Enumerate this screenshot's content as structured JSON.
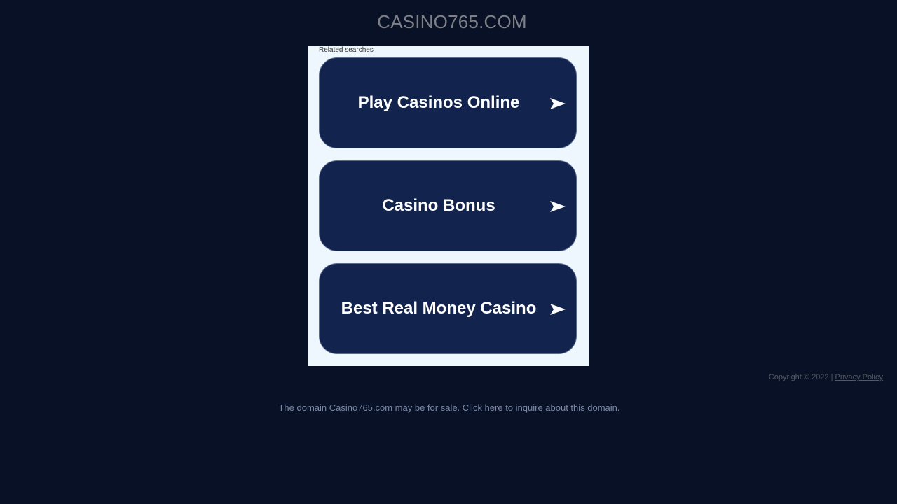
{
  "header": {
    "domain_title": "CASINO765.COM"
  },
  "related": {
    "label": "Related searches",
    "items": [
      {
        "label": "Play Casinos Online"
      },
      {
        "label": "Casino Bonus"
      },
      {
        "label": "Best Real Money Casino"
      }
    ],
    "arrow_icon": "arrow-right-icon"
  },
  "footer": {
    "copyright_text": "Copyright © 2022 |",
    "privacy_link": "Privacy Policy",
    "sale_notice": "The domain Casino765.com may be for sale. Click here to inquire about this domain."
  },
  "colors": {
    "background": "#091126",
    "panel": "#eef7fd",
    "button": "#12244d",
    "button_text": "#ffffff"
  }
}
